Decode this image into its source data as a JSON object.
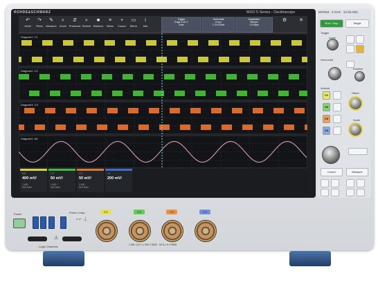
{
  "header": {
    "brand": "ROHDE&SCHWARZ",
    "series": "MXO 5 Series - Oscilloscope",
    "model_info": "MXO54 · 2 GHz · 12 bit ADC"
  },
  "toolbar": {
    "buttons": [
      {
        "label": "Undo",
        "icon": "undo-icon",
        "glyph": "↶"
      },
      {
        "label": "Redo",
        "icon": "redo-icon",
        "glyph": "↷"
      },
      {
        "label": "Measure",
        "icon": "ruler-icon",
        "glyph": "✎"
      },
      {
        "label": "Zoom",
        "icon": "zoom-icon",
        "glyph": "⌕"
      },
      {
        "label": "Protocols",
        "icon": "protocol-icon",
        "glyph": "⇵"
      },
      {
        "label": "Search",
        "icon": "search-icon",
        "glyph": "⌕"
      },
      {
        "label": "Markers",
        "icon": "marker-icon",
        "glyph": "■"
      },
      {
        "label": "Meas",
        "icon": "chart-icon",
        "glyph": "≡"
      },
      {
        "label": "Cursor",
        "icon": "cursor-icon",
        "glyph": "+"
      },
      {
        "label": "Menu",
        "icon": "menu-icon",
        "glyph": "▭"
      },
      {
        "label": "Info",
        "icon": "info-icon",
        "glyph": "i"
      }
    ],
    "trigger": {
      "title": "Trigger",
      "mode": "Edge",
      "level": "1.00 V",
      "source": "Auto"
    },
    "horizontal": {
      "title": "Horizontal",
      "scale": "5 ms/",
      "rate": "1.25 GSa/s"
    },
    "acquisition": {
      "title": "Acquisition",
      "mode": "Sample",
      "points": "1.6 Mpts"
    }
  },
  "waveforms": [
    {
      "label": "Diagram1: C1",
      "color": "#c8c83a"
    },
    {
      "label": "Diagram2: C2",
      "color": "#3fb62f"
    },
    {
      "label": "Diagram3: C3",
      "color": "#d86a2a"
    },
    {
      "label": "Diagram4: M1",
      "color": "#d6a0b0"
    }
  ],
  "channels": [
    {
      "name": "C1",
      "value": "400 mV/",
      "extra": "1 MΩ\n500 MHz",
      "color": "#d9d43a"
    },
    {
      "name": "C2",
      "value": "50 mV/",
      "extra": "1 MΩ\n500 MHz",
      "color": "#3cc03a"
    },
    {
      "name": "C3",
      "value": "50 mV/",
      "extra": "1 MΩ\n500 MHz",
      "color": "#e0752e"
    },
    {
      "name": "M1",
      "value": "200 mV/",
      "extra": "",
      "color": "#3b6fd1"
    }
  ],
  "right_panel": {
    "run_stop": "Run / Stop",
    "single": "Single",
    "trigger": "Trigger",
    "level": "Level",
    "horizontal": "Horizontal",
    "position": "Position",
    "vertical": "Vertical",
    "scale": "Scale",
    "offset": "Offset",
    "cursor": "Cursor",
    "measure": "Measure",
    "channel_buttons": [
      "C1",
      "C2",
      "C3",
      "C4"
    ]
  },
  "front": {
    "power": "Power",
    "probe_comp": "Probe Comp.",
    "logic_channels": "Logic Channels",
    "input_ch": [
      "C1",
      "C2",
      "C3",
      "C4"
    ],
    "input_colors": [
      "#e6e24a",
      "#5fcf4e",
      "#f0913e",
      "#6f8fe3"
    ],
    "warning": "1 MΩ: CAT I ≤ 300 V RMS · 50 Ω ≤ 5 V RMS"
  }
}
